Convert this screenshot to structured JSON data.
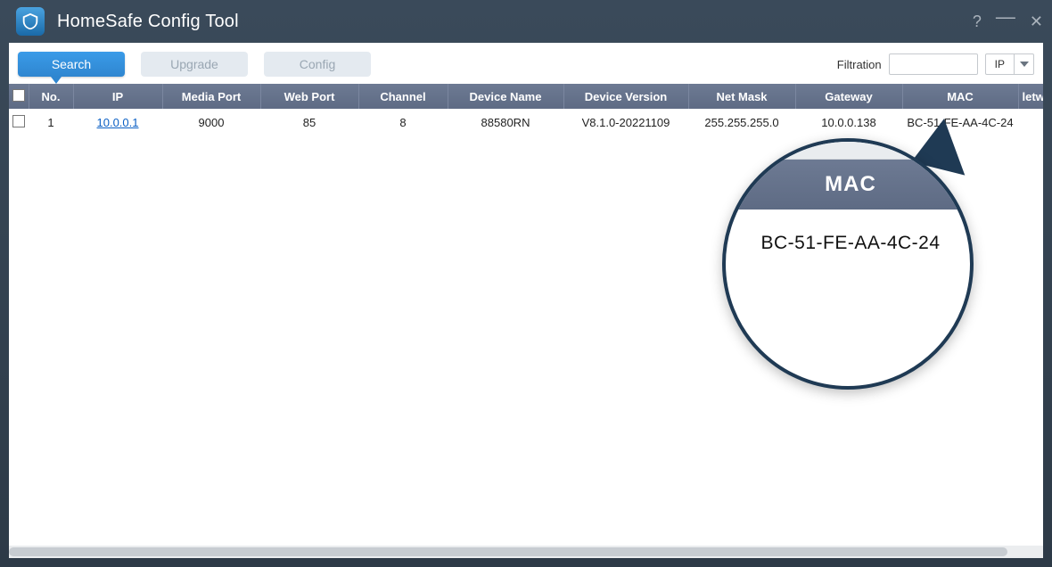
{
  "titlebar": {
    "title": "HomeSafe Config Tool"
  },
  "tabs": {
    "search": "Search",
    "upgrade": "Upgrade",
    "config": "Config"
  },
  "filtration": {
    "label": "Filtration",
    "value": "",
    "select_value": "IP"
  },
  "table": {
    "headers": {
      "no": "No.",
      "ip": "IP",
      "media_port": "Media Port",
      "web_port": "Web Port",
      "channel": "Channel",
      "device_name": "Device Name",
      "device_version": "Device Version",
      "net_mask": "Net Mask",
      "gateway": "Gateway",
      "mac": "MAC",
      "network_partial": "letw"
    },
    "rows": [
      {
        "no": "1",
        "ip": "10.0.0.1",
        "media_port": "9000",
        "web_port": "85",
        "channel": "8",
        "device_name": "88580RN",
        "device_version": "V8.1.0-20221109",
        "net_mask": "255.255.255.0",
        "gateway": "10.0.0.138",
        "mac": "BC-51-FE-AA-4C-24"
      }
    ]
  },
  "callout": {
    "header": "MAC",
    "value": "BC-51-FE-AA-4C-24"
  }
}
